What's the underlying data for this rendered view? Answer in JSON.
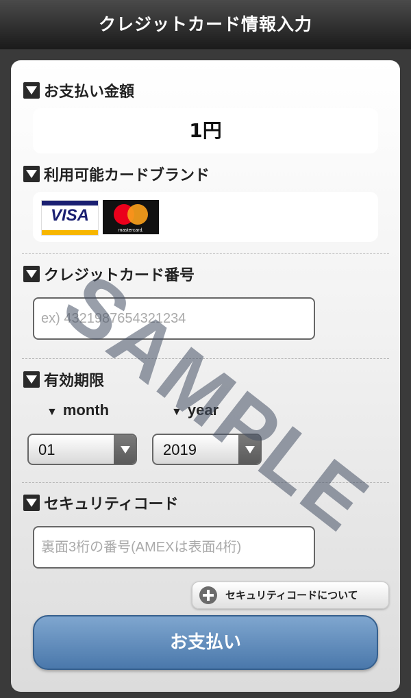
{
  "header": {
    "title": "クレジットカード情報入力"
  },
  "amount_section": {
    "title": "お支払い金額",
    "value": "1円"
  },
  "brands_section": {
    "title": "利用可能カードブランド",
    "brands": [
      {
        "name": "VISA"
      },
      {
        "name": "mastercard."
      }
    ]
  },
  "card_number_section": {
    "title": "クレジットカード番号",
    "placeholder": "ex) 4321987654321234"
  },
  "expiry_section": {
    "title": "有効期限",
    "month_label": "month",
    "year_label": "year",
    "month_value": "01",
    "year_value": "2019",
    "label_marker": "▼"
  },
  "security_section": {
    "title": "セキュリティコード",
    "placeholder": "裏面3桁の番号(AMEXは表面4桁)",
    "help_button": "セキュリティコードについて"
  },
  "pay_button": {
    "label": "お支払い"
  },
  "watermark": {
    "text": "SAMPLE"
  }
}
